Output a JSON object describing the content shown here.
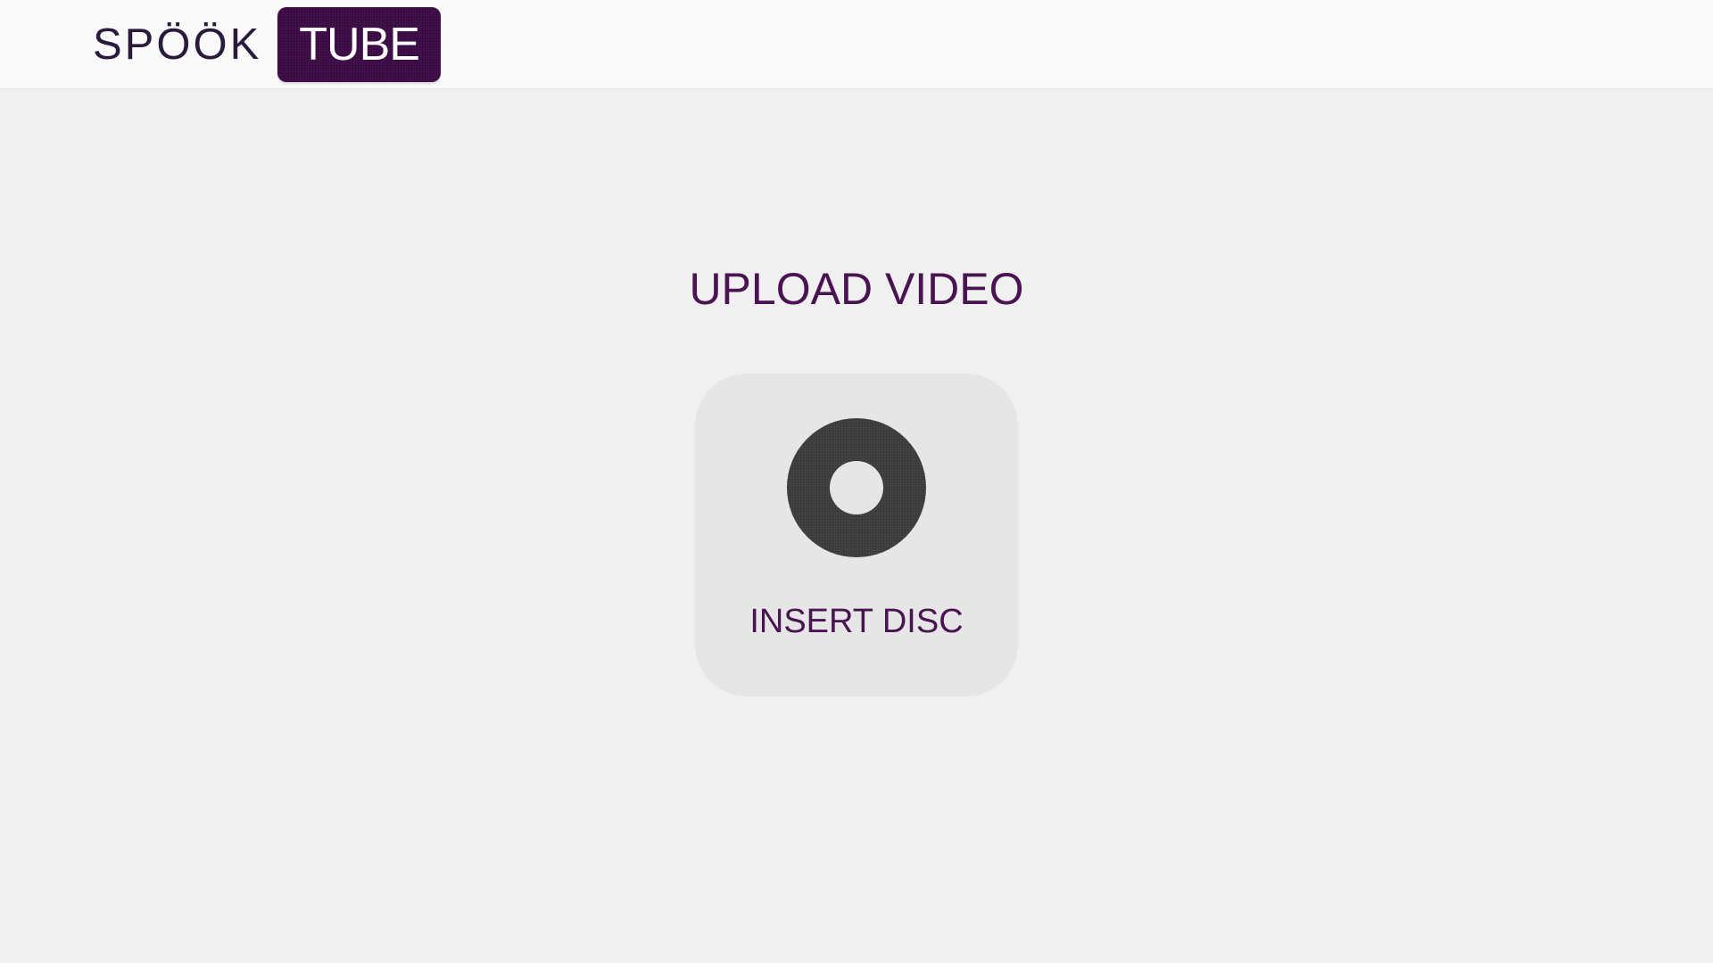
{
  "header": {
    "logo_word": "SPÖÖK",
    "logo_badge": "TUBE"
  },
  "main": {
    "title": "UPLOAD VIDEO",
    "upload_card": {
      "icon": "disc-icon",
      "label": "INSERT DISC"
    }
  },
  "colors": {
    "brand_purple": "#45104f",
    "title_purple": "#4a1352",
    "disc_gray": "#444444",
    "card_bg": "#e6e6e6",
    "page_bg": "#f0f0f0",
    "header_bg": "#fafafa"
  }
}
